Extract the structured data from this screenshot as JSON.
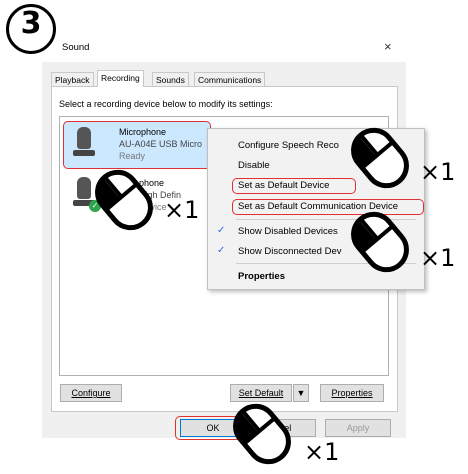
{
  "step": "3",
  "window": {
    "title": "Sound",
    "close_glyph": "×"
  },
  "tabs": [
    "Playback",
    "Recording",
    "Sounds",
    "Communications"
  ],
  "active_tab": "Recording",
  "instruction": "Select a recording device below to modify its settings:",
  "devices": [
    {
      "name": "Microphone",
      "sub": "AU-A04E USB Micro",
      "status": "Ready",
      "icon": "microphone-icon"
    },
    {
      "name": "phone",
      "sub": "High Defin",
      "status": "Device",
      "icon": "microphone-icon"
    }
  ],
  "context_menu": {
    "items": [
      "Configure Speech Reco",
      "Disable",
      "Set as Default Device",
      "Set as Default Communication Device",
      "Show Disabled Devices",
      "Show Disconnected Dev",
      "Properties"
    ],
    "checked": [
      "Show Disabled Devices",
      "Show Disconnected Dev"
    ]
  },
  "buttons": {
    "configure": "Configure",
    "set_default": "Set Default",
    "properties": "Properties",
    "ok": "OK",
    "cancel": "ncel",
    "apply": "Apply"
  },
  "annotations": {
    "times1": "×1",
    "times2": "×1",
    "times3": "×1",
    "times4": "×1"
  },
  "colors": {
    "highlight": "#e03030",
    "selection": "#cce8ff",
    "check": "#2a6ee0"
  }
}
